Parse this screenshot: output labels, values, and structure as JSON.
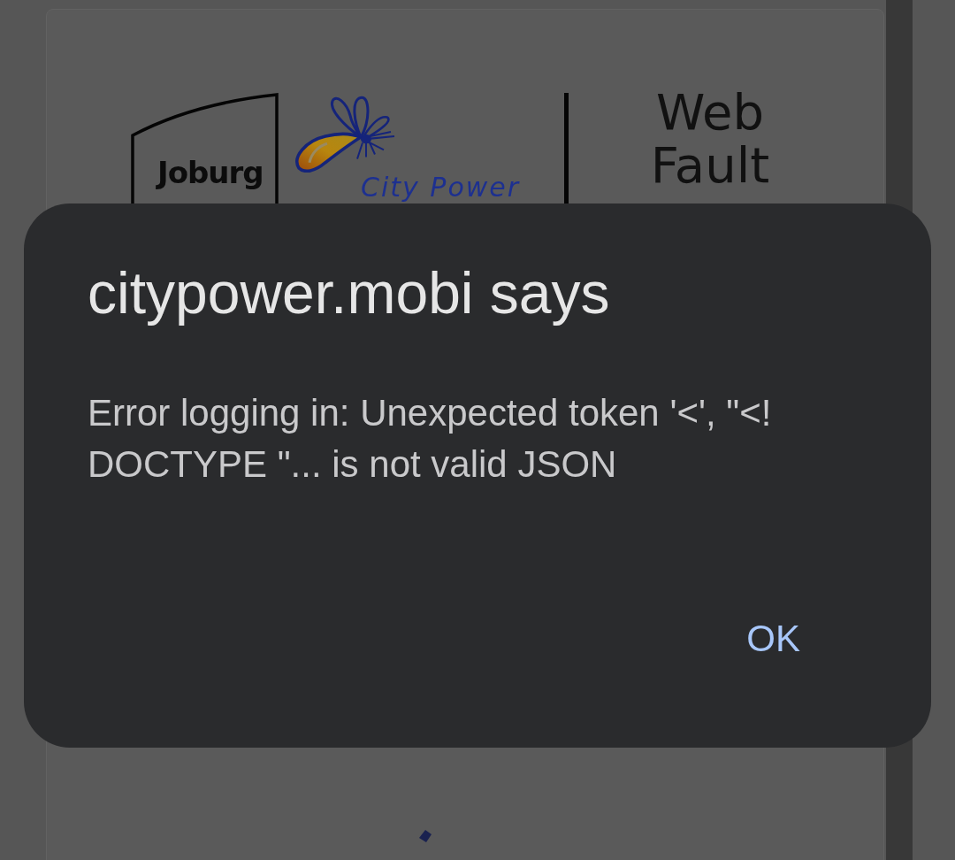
{
  "page": {
    "header": {
      "logos": [
        {
          "kind": "joburg",
          "text": "Joburg"
        },
        {
          "kind": "city_power",
          "text": "City Power"
        }
      ],
      "title": "Web Fault"
    }
  },
  "dialog": {
    "title": "citypower.mobi says",
    "message": "Error logging in: Unexpected token '<', \"<!DOCTYPE \"... is not valid JSON",
    "buttons": [
      {
        "label": "OK"
      }
    ]
  }
}
